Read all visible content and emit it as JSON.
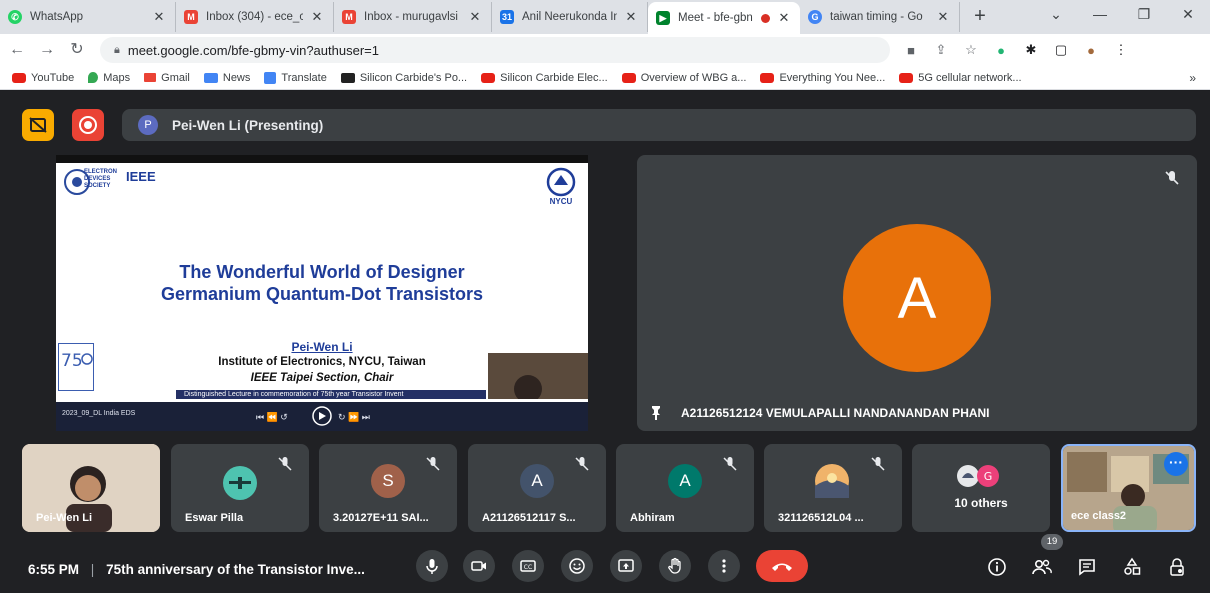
{
  "browser": {
    "tabs": [
      {
        "title": "WhatsApp",
        "icon": "whatsapp-icon",
        "color": "#25d366"
      },
      {
        "title": "Inbox (304) - ece_c",
        "icon": "gmail-icon",
        "color": "#ea4335"
      },
      {
        "title": "Inbox - murugavlsi",
        "icon": "gmail-icon",
        "color": "#ea4335"
      },
      {
        "title": "Anil Neerukonda In",
        "icon": "calendar-icon",
        "color": "#1a73e8"
      },
      {
        "title": "Meet - bfe-gbn",
        "icon": "meet-icon",
        "color": "#00832d",
        "active": true
      },
      {
        "title": "taiwan timing - Go",
        "icon": "google-icon",
        "color": "#4285f4"
      }
    ],
    "url": "meet.google.com/bfe-gbmy-vin?authuser=1",
    "bookmarks": [
      {
        "label": "YouTube",
        "icon": "youtube-icon"
      },
      {
        "label": "Maps",
        "icon": "maps-icon"
      },
      {
        "label": "Gmail",
        "icon": "gmail-icon"
      },
      {
        "label": "News",
        "icon": "news-icon"
      },
      {
        "label": "Translate",
        "icon": "translate-icon"
      },
      {
        "label": "Silicon Carbide's Po...",
        "icon": "video-icon"
      },
      {
        "label": "Silicon Carbide Elec...",
        "icon": "youtube-icon"
      },
      {
        "label": "Overview of WBG a...",
        "icon": "youtube-icon"
      },
      {
        "label": "Everything You Nee...",
        "icon": "youtube-icon"
      },
      {
        "label": "5G cellular network...",
        "icon": "youtube-icon"
      }
    ]
  },
  "meet": {
    "presenting_label": "Pei-Wen Li (Presenting)",
    "presenter_initial": "P",
    "slide": {
      "title_line1": "The Wonderful World of Designer",
      "title_line2": "Germanium Quantum-Dot Transistors",
      "author": "Pei-Wen Li",
      "institute": "Institute of Electronics, NYCU, Taiwan",
      "section": "IEEE Taipei Section, Chair",
      "logo_ieee": "IEEE",
      "logo_eds": "ELECTRON DEVICES SOCIETY",
      "logo_nycu": "NYCU",
      "video_label": "2023_09_DL India EDS",
      "banner": "Distinguished Lecture in commemoration of 75th year Transistor Invent"
    },
    "pinned": {
      "initial": "A",
      "name": "A21126512124 VEMULAPALLI NANDANANDAN PHANI",
      "avatar_color": "#e8710a"
    },
    "participants": [
      {
        "name": "Pei-Wen Li",
        "kind": "video"
      },
      {
        "name": "Eswar Pilla",
        "kind": "image"
      },
      {
        "name": "3.20127E+11 SAI...",
        "initial": "S",
        "color": "#a0614a"
      },
      {
        "name": "A21126512117 S...",
        "initial": "A",
        "color": "#43536b"
      },
      {
        "name": "Abhiram",
        "initial": "A",
        "color": "#00796b"
      },
      {
        "name": "321126512L04 ...",
        "kind": "image"
      },
      {
        "name": "10 others",
        "kind": "others"
      },
      {
        "name": "ece class2",
        "kind": "self"
      }
    ],
    "others_badge": "G",
    "bottom": {
      "time": "6:55 PM",
      "separator": "|",
      "meeting_title": "75th anniversary of the Transistor Inve...",
      "people_count": "19"
    }
  }
}
